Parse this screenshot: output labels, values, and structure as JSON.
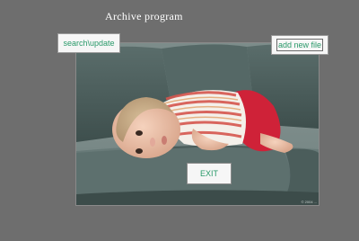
{
  "app": {
    "title": "Archive program"
  },
  "toolbar": {
    "search_label": "search\\update",
    "add_label": "add new file",
    "exit_label": "EXIT"
  },
  "photo": {
    "copyright": "© 2004 ..."
  },
  "colors": {
    "background": "#6e6e6e",
    "button_text": "#2a9a6a",
    "button_bg": "#f6f6f6"
  }
}
